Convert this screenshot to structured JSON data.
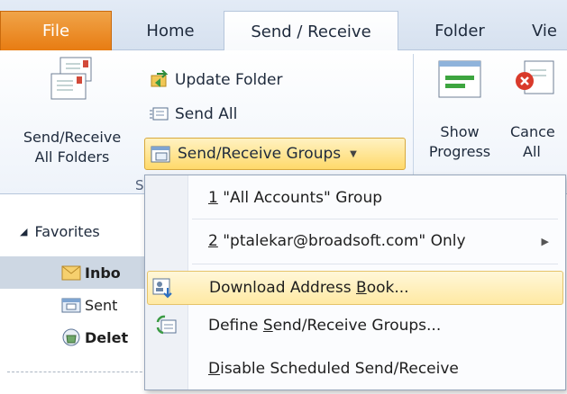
{
  "tabs": {
    "file": "File",
    "home": "Home",
    "send_receive": "Send / Receive",
    "folder": "Folder",
    "view": "Vie"
  },
  "ribbon": {
    "send_receive_all": [
      "Send/Receive",
      "All Folders"
    ],
    "update_folder": "Update Folder",
    "send_all": "Send All",
    "send_receive_groups": "Send/Receive Groups",
    "group_caption": "S",
    "show_progress": [
      "Show",
      "Progress"
    ],
    "cancel_all": [
      "Cance",
      "All"
    ]
  },
  "folder_pane": {
    "favorites": "Favorites",
    "folders": [
      {
        "label": "Inbo",
        "selected": true,
        "icon": "inbox-folder-icon"
      },
      {
        "label": "Sent",
        "selected": false,
        "icon": "sent-folder-icon"
      },
      {
        "label": "Delet",
        "selected": false,
        "icon": "deleted-folder-icon"
      }
    ]
  },
  "menu": {
    "items": [
      {
        "pre": "",
        "key": "1",
        "post": " \"All Accounts\" Group"
      },
      {
        "pre": "",
        "key": "2",
        "post": " \"ptalekar@broadsoft.com\" Only"
      },
      {
        "pre": "Download Address ",
        "key": "B",
        "post": "ook..."
      },
      {
        "pre": "Define ",
        "key": "S",
        "post": "end/Receive Groups..."
      },
      {
        "pre": "",
        "key": "D",
        "post": "isable Scheduled Send/Receive"
      }
    ]
  },
  "colors": {
    "file_tab": "#e87c12",
    "highlight": "#ffe9a3",
    "selected_folder": "#cdd7e3"
  }
}
